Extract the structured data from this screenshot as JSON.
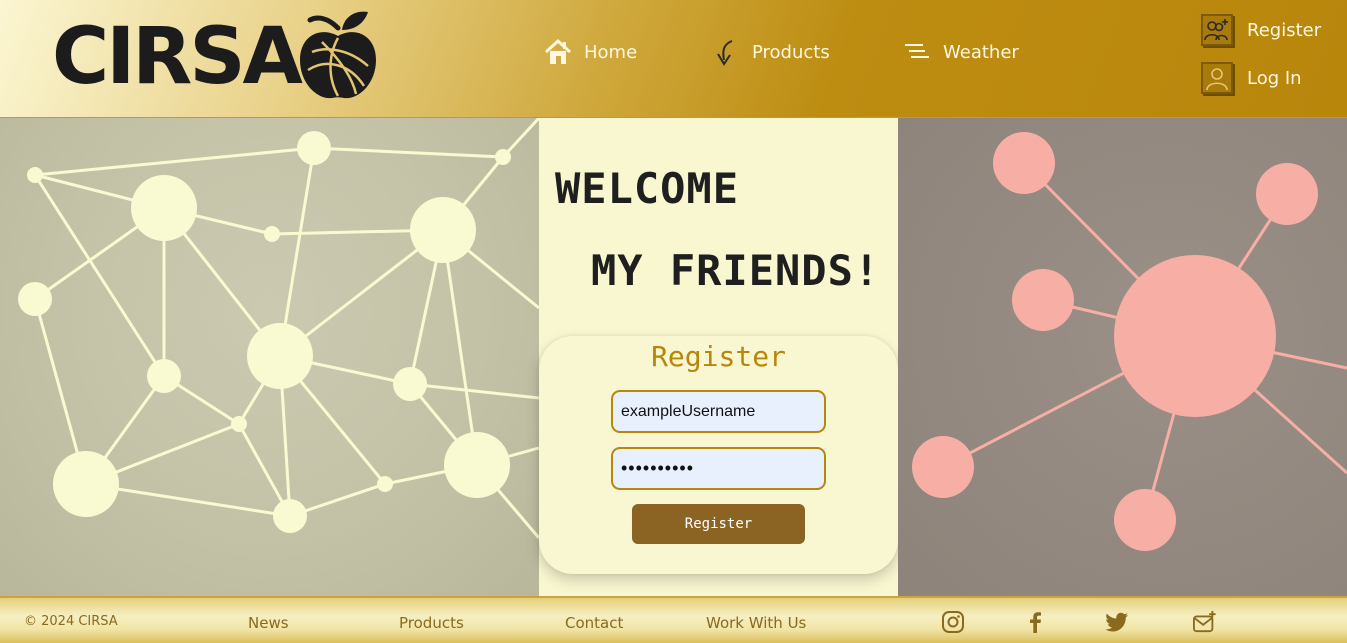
{
  "brand": {
    "name": "CIRSA"
  },
  "nav": {
    "home": "Home",
    "products": "Products",
    "weather": "Weather"
  },
  "account": {
    "register": "Register",
    "login": "Log In"
  },
  "hero": {
    "line1": "WELCOME",
    "line2": "MY FRIENDS!"
  },
  "register_form": {
    "title": "Register",
    "username_value": "exampleUsername",
    "password_masked": "••••••••••",
    "submit_label": "Register"
  },
  "footer": {
    "copyright": "© 2024 CIRSA",
    "links": [
      "News",
      "Products",
      "Contact",
      "Work With Us"
    ],
    "social_icons": [
      "instagram-icon",
      "facebook-icon",
      "twitter-icon",
      "mail-plus-icon"
    ]
  },
  "colors": {
    "accent_gold": "#b8860b",
    "cream": "#f8f7d0",
    "button_brown": "#8b6423",
    "node_cream": "#fafad2",
    "node_pink": "#f7aea5"
  }
}
